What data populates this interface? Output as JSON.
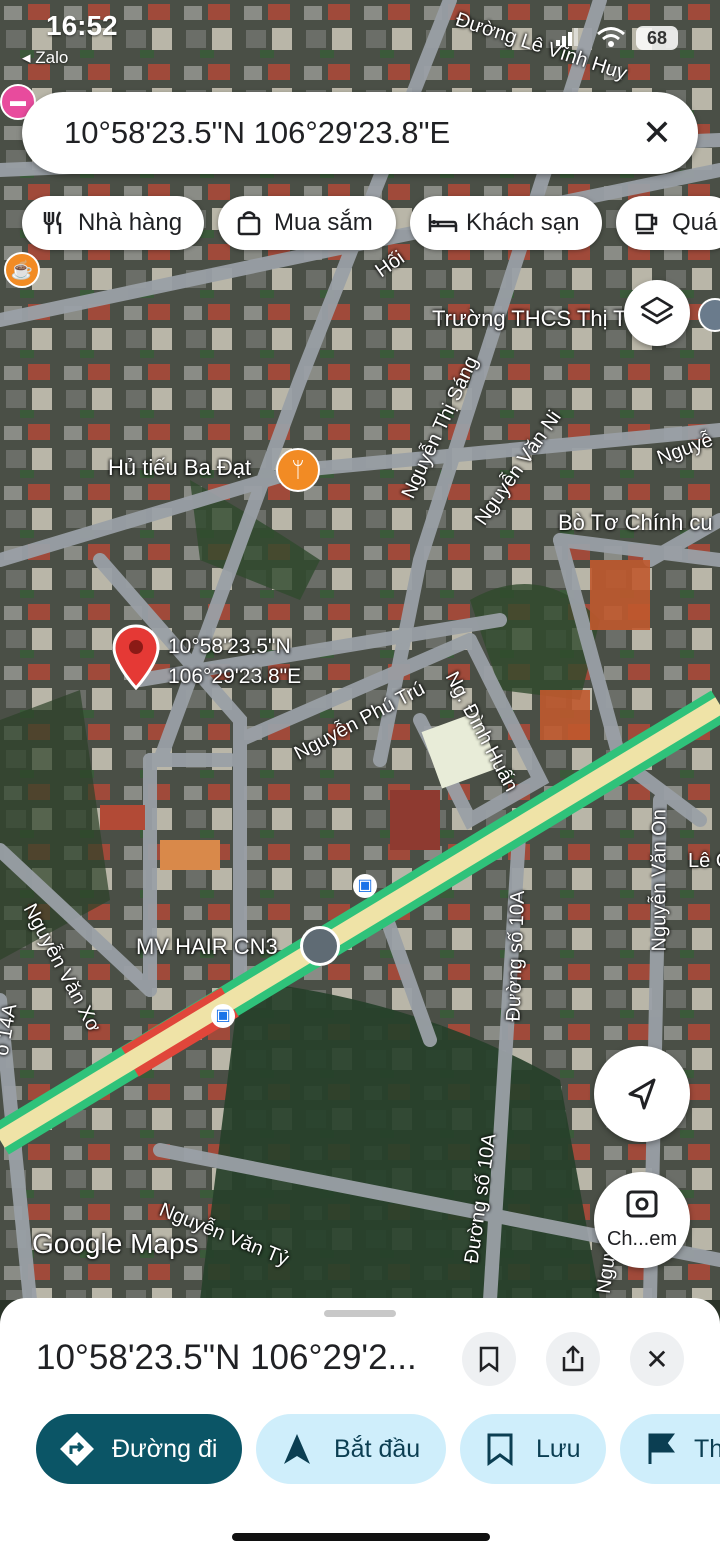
{
  "status_bar": {
    "time": "16:52",
    "back_app": "◂ Zalo",
    "battery": "68"
  },
  "search": {
    "query": "10°58'23.5\"N 106°29'23.8\"E"
  },
  "chips": [
    {
      "label": "Nhà hàng",
      "icon": "restaurant-icon"
    },
    {
      "label": "Mua sắm",
      "icon": "shopping-bag-icon"
    },
    {
      "label": "Khách sạn",
      "icon": "hotel-bed-icon"
    },
    {
      "label": "Quá",
      "icon": "cafe-cup-icon"
    }
  ],
  "map": {
    "pin_label_line1": "10°58'23.5\"N",
    "pin_label_line2": "106°29'23.8\"E",
    "places": {
      "restaurant": "Hủ tiếu Ba Đạt",
      "school": "Trường THCS Thị T",
      "hair": "MV HAIR CN3",
      "church": "Bò Tơ Chính cu"
    },
    "roads": {
      "le_vinh_huy": "Đường Lê Vĩnh Huy",
      "hoi": "Hối",
      "thi_sang": "Nguyễn Thị Sáng",
      "van_ni": "Nguyễn Văn Ni",
      "nguyen_r": "Nguyễ",
      "phu_tru": "Nguyễn Phú Trú",
      "dinh_huan": "Ng. Đình Huấn",
      "van_on": "Nguyễn Văn On",
      "le_c": "Lê C",
      "duong10a_a": "Đường số 10A",
      "duong10a_b": "Đường số 10A",
      "van_xo": "Nguyễn Văn Xơ",
      "van_ty": "Nguyễn Văn Tỷ",
      "nguyen_on2": "Nguyễn On",
      "so14a": "ố 14A"
    },
    "watermark": "Google Maps",
    "street_view_label": "Ch...em",
    "colors": {
      "traffic_green": "#2fc27a",
      "traffic_red": "#e0463a",
      "highway": "#efe3a7",
      "pin": "#e53935",
      "place_orange": "#f28b24"
    }
  },
  "sheet": {
    "title": "10°58'23.5\"N 106°29'2...",
    "actions": [
      {
        "label": "Đường đi",
        "icon": "directions-icon"
      },
      {
        "label": "Bắt đầu",
        "icon": "navigation-arrow-icon"
      },
      {
        "label": "Lưu",
        "icon": "bookmark-icon"
      },
      {
        "label": "Th",
        "icon": "flag-icon"
      }
    ]
  }
}
